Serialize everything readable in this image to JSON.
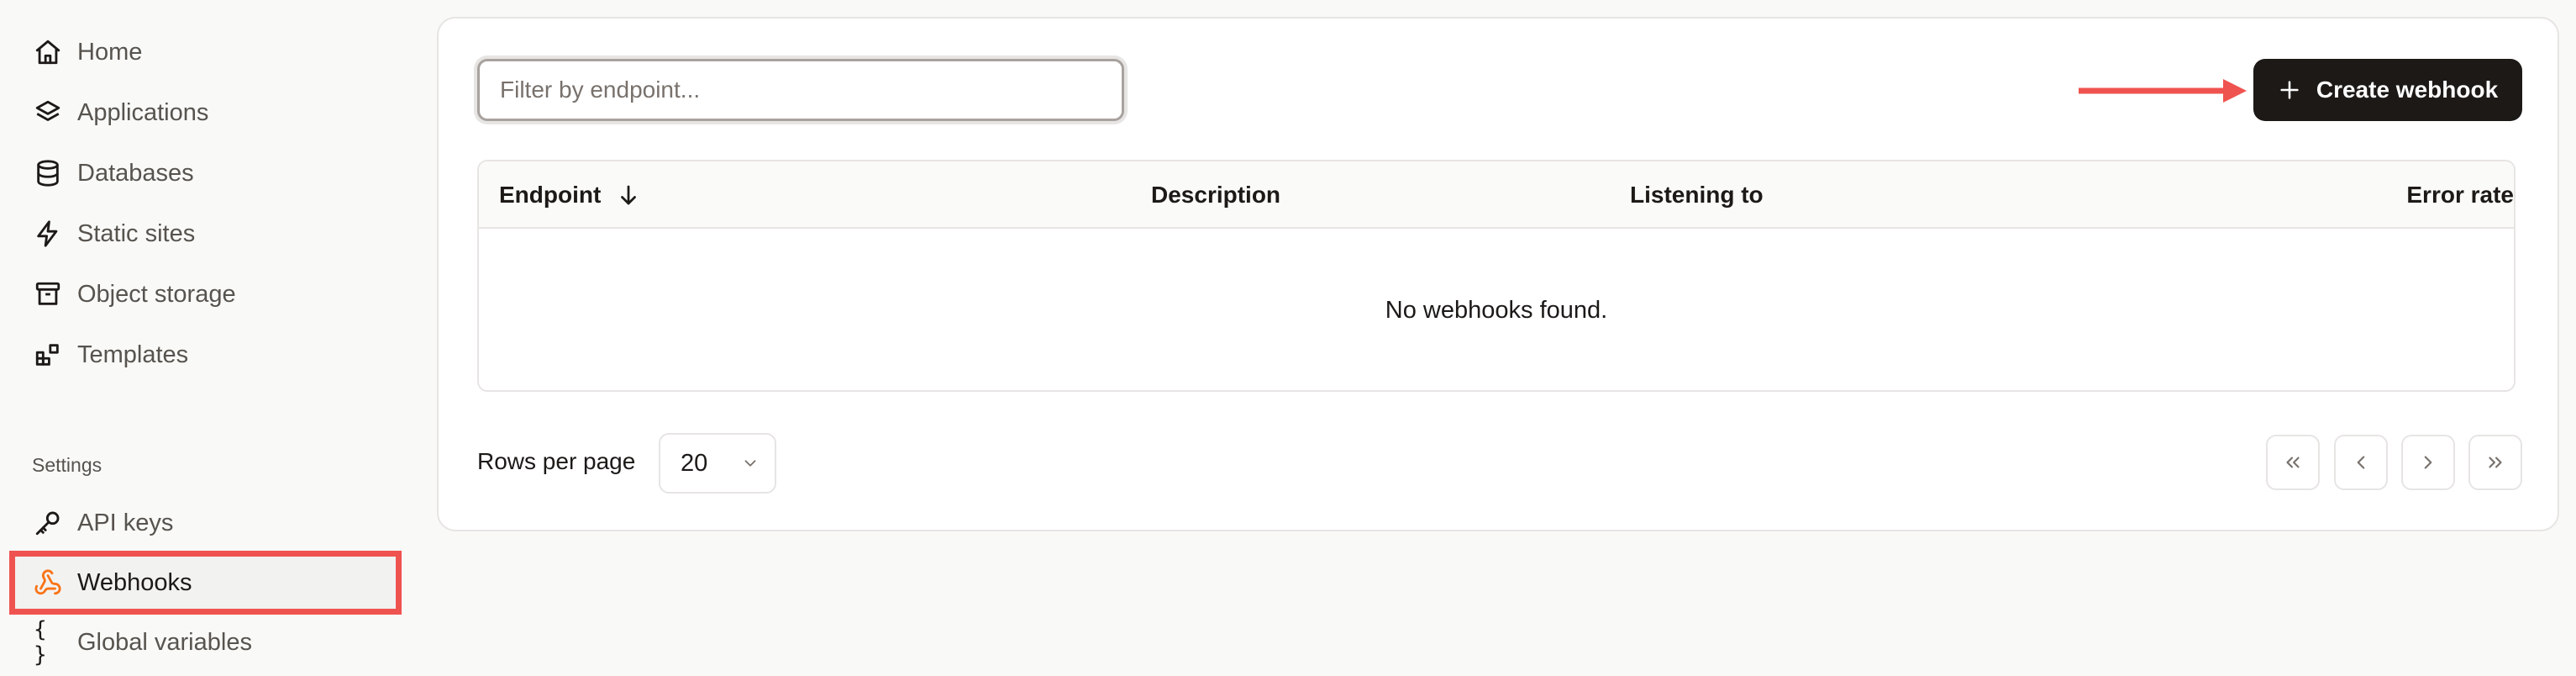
{
  "sidebar": {
    "items": [
      {
        "label": "Home",
        "icon": "home-icon"
      },
      {
        "label": "Applications",
        "icon": "layers-icon"
      },
      {
        "label": "Databases",
        "icon": "database-icon"
      },
      {
        "label": "Static sites",
        "icon": "zap-icon"
      },
      {
        "label": "Object storage",
        "icon": "archive-icon"
      },
      {
        "label": "Templates",
        "icon": "blocks-icon"
      }
    ],
    "settings_label": "Settings",
    "settings_items": [
      {
        "label": "API keys",
        "icon": "key-icon"
      },
      {
        "label": "Webhooks",
        "icon": "webhook-icon",
        "active": true
      },
      {
        "label": "Global variables",
        "icon": "braces-icon",
        "glyph": "{ }"
      }
    ]
  },
  "main": {
    "filter_placeholder": "Filter by endpoint...",
    "filter_value": "",
    "create_button_label": "Create webhook",
    "table": {
      "columns": [
        "Endpoint",
        "Description",
        "Listening to",
        "Error rate"
      ],
      "sort_column": "Endpoint",
      "sort_direction": "descending",
      "empty_message": "No webhooks found."
    },
    "pagination": {
      "rows_per_page_label": "Rows per page",
      "rows_per_page_value": "20"
    }
  },
  "colors": {
    "primary_button": "#1c1917",
    "highlight": "#ef5350",
    "webhook_icon": "#f97316",
    "background": "#f9f9f8"
  }
}
